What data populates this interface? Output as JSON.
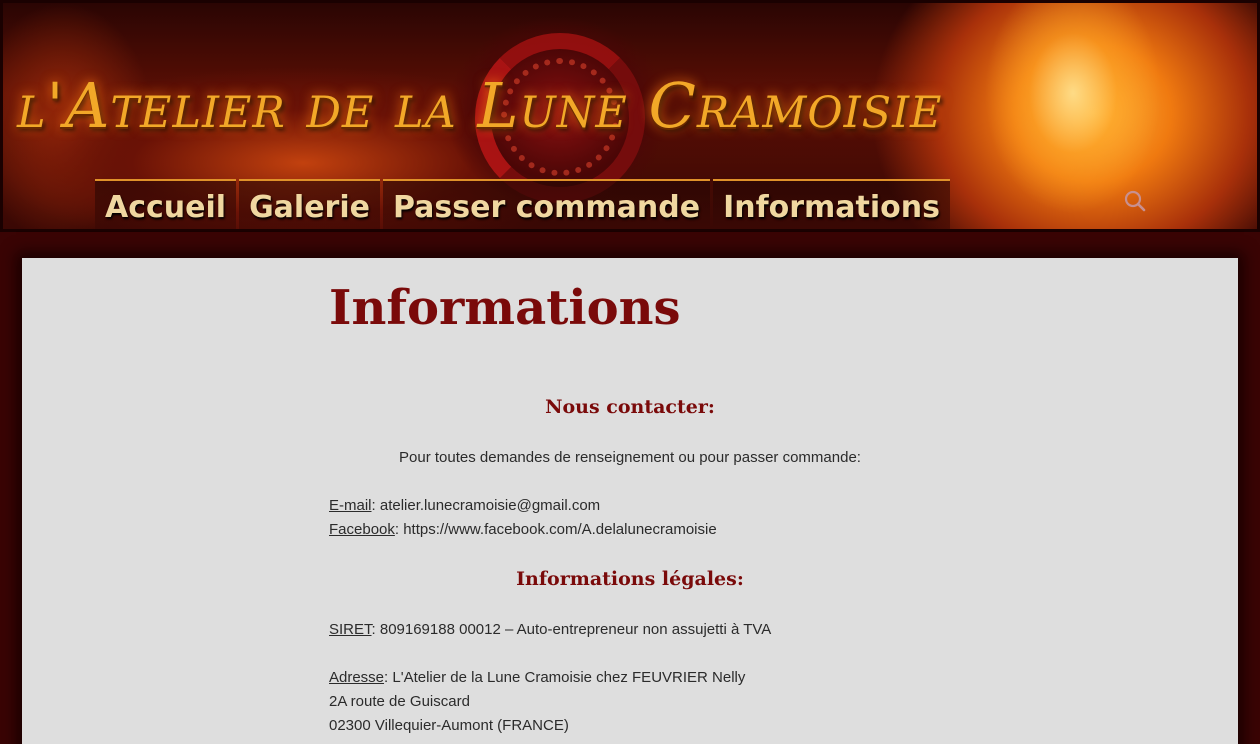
{
  "header": {
    "site_title": "l'Atelier de la Lune Cramoisie",
    "nav": [
      "Accueil",
      "Galerie",
      "Passer commande",
      "Informations"
    ],
    "search_icon": "search-icon"
  },
  "page": {
    "title": "Informations",
    "contact_heading": "Nous contacter:",
    "contact_intro": "Pour toutes demandes de renseignement ou pour passer commande:",
    "email_label": "E-mail",
    "email_value": ": atelier.lunecramoisie@gmail.com",
    "facebook_label": "Facebook",
    "facebook_value": ": https://www.facebook.com/A.delalunecramoisie",
    "legal_heading": "Informations légales:",
    "siret_label": "SIRET",
    "siret_value": ": 809169188 00012 – Auto-entrepreneur non assujetti à TVA",
    "address_label": "Adresse",
    "address_value": ": L'Atelier de la Lune Cramoisie chez FEUVRIER Nelly",
    "address_line2": "2A route de Guiscard",
    "address_line3": "02300 Villequier-Aumont (FRANCE)"
  },
  "colors": {
    "heading": "#7a0a0a",
    "title_gold": "#f2a828",
    "nav_text": "#f0d7a0",
    "content_bg": "#dedede",
    "page_bg": "#3a0404"
  }
}
